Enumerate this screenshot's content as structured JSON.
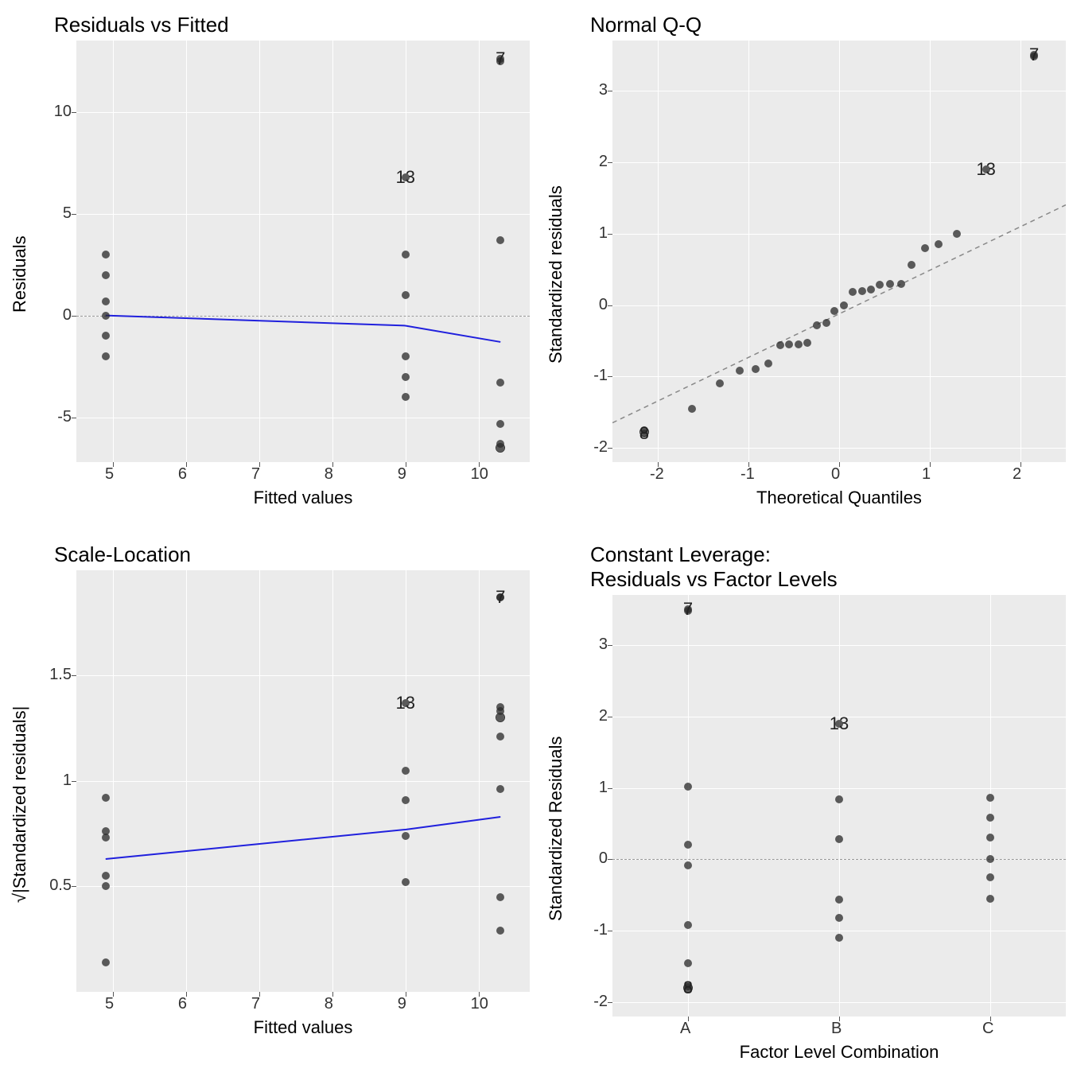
{
  "chart_data": [
    {
      "id": "p1",
      "type": "scatter",
      "title": "Residuals vs Fitted",
      "xlabel": "Fitted values",
      "ylabel": "Residuals",
      "xlim": [
        4.5,
        10.7
      ],
      "ylim": [
        -7.2,
        13.5
      ],
      "xticks": [
        5,
        6,
        7,
        8,
        9,
        10
      ],
      "yticks": [
        -5,
        0,
        5,
        10
      ],
      "refline_y": 0,
      "smooth": [
        [
          4.9,
          0.0
        ],
        [
          9.0,
          -0.5
        ],
        [
          10.3,
          -1.3
        ]
      ],
      "points": [
        {
          "x": 4.9,
          "y": 3.0
        },
        {
          "x": 4.9,
          "y": 2.0
        },
        {
          "x": 4.9,
          "y": 0.7
        },
        {
          "x": 4.9,
          "y": 0.0
        },
        {
          "x": 4.9,
          "y": -1.0
        },
        {
          "x": 4.9,
          "y": -2.0
        },
        {
          "x": 9.0,
          "y": 6.8
        },
        {
          "x": 9.0,
          "y": 3.0
        },
        {
          "x": 9.0,
          "y": 1.0
        },
        {
          "x": 9.0,
          "y": -2.0
        },
        {
          "x": 9.0,
          "y": -3.0
        },
        {
          "x": 9.0,
          "y": -4.0
        },
        {
          "x": 10.3,
          "y": 12.6
        },
        {
          "x": 10.3,
          "y": 12.5
        },
        {
          "x": 10.3,
          "y": 3.7
        },
        {
          "x": 10.3,
          "y": -3.3
        },
        {
          "x": 10.3,
          "y": -5.3
        },
        {
          "x": 10.3,
          "y": -6.3
        },
        {
          "x": 10.3,
          "y": -6.5
        }
      ],
      "annotations": [
        {
          "label": "7",
          "x": 10.3,
          "y": 12.6
        },
        {
          "label": "13",
          "x": 9.0,
          "y": 6.8
        }
      ],
      "open_points": [
        {
          "x": 10.3,
          "y": -6.5
        }
      ]
    },
    {
      "id": "p2",
      "type": "scatter",
      "title": "Normal Q-Q",
      "xlabel": "Theoretical Quantiles",
      "ylabel": "Standardized residuals",
      "xlim": [
        -2.5,
        2.5
      ],
      "ylim": [
        -2.2,
        3.7
      ],
      "xticks": [
        -2,
        -1,
        0,
        1,
        2
      ],
      "yticks": [
        -2,
        -1,
        0,
        1,
        2,
        3
      ],
      "refline_diag": [
        [
          -2.5,
          -1.65
        ],
        [
          2.5,
          1.4
        ]
      ],
      "points": [
        {
          "x": -2.15,
          "y": -1.8
        },
        {
          "x": -2.15,
          "y": -1.75
        },
        {
          "x": -1.62,
          "y": -1.45
        },
        {
          "x": -1.32,
          "y": -1.1
        },
        {
          "x": -1.1,
          "y": -0.92
        },
        {
          "x": -0.92,
          "y": -0.9
        },
        {
          "x": -0.78,
          "y": -0.82
        },
        {
          "x": -0.65,
          "y": -0.56
        },
        {
          "x": -0.55,
          "y": -0.55
        },
        {
          "x": -0.45,
          "y": -0.55
        },
        {
          "x": -0.35,
          "y": -0.53
        },
        {
          "x": -0.25,
          "y": -0.28
        },
        {
          "x": -0.14,
          "y": -0.25
        },
        {
          "x": -0.05,
          "y": -0.08
        },
        {
          "x": 0.05,
          "y": 0.0
        },
        {
          "x": 0.15,
          "y": 0.18
        },
        {
          "x": 0.25,
          "y": 0.2
        },
        {
          "x": 0.35,
          "y": 0.22
        },
        {
          "x": 0.45,
          "y": 0.28
        },
        {
          "x": 0.56,
          "y": 0.3
        },
        {
          "x": 0.68,
          "y": 0.3
        },
        {
          "x": 0.8,
          "y": 0.56
        },
        {
          "x": 0.95,
          "y": 0.8
        },
        {
          "x": 1.1,
          "y": 0.85
        },
        {
          "x": 1.3,
          "y": 1.0
        },
        {
          "x": 1.62,
          "y": 1.9
        },
        {
          "x": 2.15,
          "y": 3.48
        },
        {
          "x": 2.15,
          "y": 3.5
        }
      ],
      "annotations": [
        {
          "label": "7",
          "x": 2.15,
          "y": 3.5
        },
        {
          "label": "13",
          "x": 1.62,
          "y": 1.9
        },
        {
          "label": "8",
          "x": -2.15,
          "y": -1.8
        }
      ],
      "open_points": [
        {
          "x": -2.15,
          "y": -1.78
        }
      ]
    },
    {
      "id": "p3",
      "type": "scatter",
      "title": "Scale-Location",
      "xlabel": "Fitted values",
      "ylabel": "√|Standardized residuals|",
      "xlim": [
        4.5,
        10.7
      ],
      "ylim": [
        0.0,
        2.0
      ],
      "xticks": [
        5,
        6,
        7,
        8,
        9,
        10
      ],
      "yticks": [
        0.5,
        1.0,
        1.5
      ],
      "smooth": [
        [
          4.9,
          0.63
        ],
        [
          9.0,
          0.77
        ],
        [
          10.3,
          0.83
        ]
      ],
      "points": [
        {
          "x": 4.9,
          "y": 0.92
        },
        {
          "x": 4.9,
          "y": 0.76
        },
        {
          "x": 4.9,
          "y": 0.73
        },
        {
          "x": 4.9,
          "y": 0.55
        },
        {
          "x": 4.9,
          "y": 0.5
        },
        {
          "x": 4.9,
          "y": 0.14
        },
        {
          "x": 9.0,
          "y": 1.37
        },
        {
          "x": 9.0,
          "y": 1.05
        },
        {
          "x": 9.0,
          "y": 0.91
        },
        {
          "x": 9.0,
          "y": 0.74
        },
        {
          "x": 9.0,
          "y": 0.52
        },
        {
          "x": 10.3,
          "y": 1.87
        },
        {
          "x": 10.3,
          "y": 1.87
        },
        {
          "x": 10.3,
          "y": 1.35
        },
        {
          "x": 10.3,
          "y": 1.33
        },
        {
          "x": 10.3,
          "y": 1.3
        },
        {
          "x": 10.3,
          "y": 1.21
        },
        {
          "x": 10.3,
          "y": 0.96
        },
        {
          "x": 10.3,
          "y": 0.45
        },
        {
          "x": 10.3,
          "y": 0.29
        }
      ],
      "annotations": [
        {
          "label": "7",
          "x": 10.3,
          "y": 1.87
        },
        {
          "label": "13",
          "x": 9.0,
          "y": 1.37
        }
      ],
      "open_points": [
        {
          "x": 10.3,
          "y": 1.3
        }
      ]
    },
    {
      "id": "p4",
      "type": "scatter",
      "title": "Constant Leverage:\nResiduals vs Factor Levels",
      "xlabel": "Factor Level Combination",
      "ylabel": "Standardized Residuals",
      "xlim": [
        0.5,
        3.5
      ],
      "ylim": [
        -2.2,
        3.7
      ],
      "xticks_cat": [
        "A",
        "B",
        "C"
      ],
      "yticks": [
        -2,
        -1,
        0,
        1,
        2,
        3
      ],
      "refline_y": 0,
      "points": [
        {
          "x": 1,
          "y": 3.5
        },
        {
          "x": 1,
          "y": 3.48
        },
        {
          "x": 1,
          "y": 1.02
        },
        {
          "x": 1,
          "y": 0.2
        },
        {
          "x": 1,
          "y": -0.08
        },
        {
          "x": 1,
          "y": -0.92
        },
        {
          "x": 1,
          "y": -1.45
        },
        {
          "x": 1,
          "y": -1.78
        },
        {
          "x": 1,
          "y": -1.8
        },
        {
          "x": 2,
          "y": 1.9
        },
        {
          "x": 2,
          "y": 0.84
        },
        {
          "x": 2,
          "y": 0.28
        },
        {
          "x": 2,
          "y": -0.56
        },
        {
          "x": 2,
          "y": -0.82
        },
        {
          "x": 2,
          "y": -1.1
        },
        {
          "x": 3,
          "y": 0.86
        },
        {
          "x": 3,
          "y": 0.58
        },
        {
          "x": 3,
          "y": 0.3
        },
        {
          "x": 3,
          "y": 0.0
        },
        {
          "x": 3,
          "y": -0.25
        },
        {
          "x": 3,
          "y": -0.55
        }
      ],
      "annotations": [
        {
          "label": "7",
          "x": 1,
          "y": 3.5
        },
        {
          "label": "13",
          "x": 2,
          "y": 1.9
        },
        {
          "label": "8",
          "x": 1,
          "y": -1.8
        }
      ],
      "open_points": [
        {
          "x": 1,
          "y": -1.8
        }
      ]
    }
  ]
}
